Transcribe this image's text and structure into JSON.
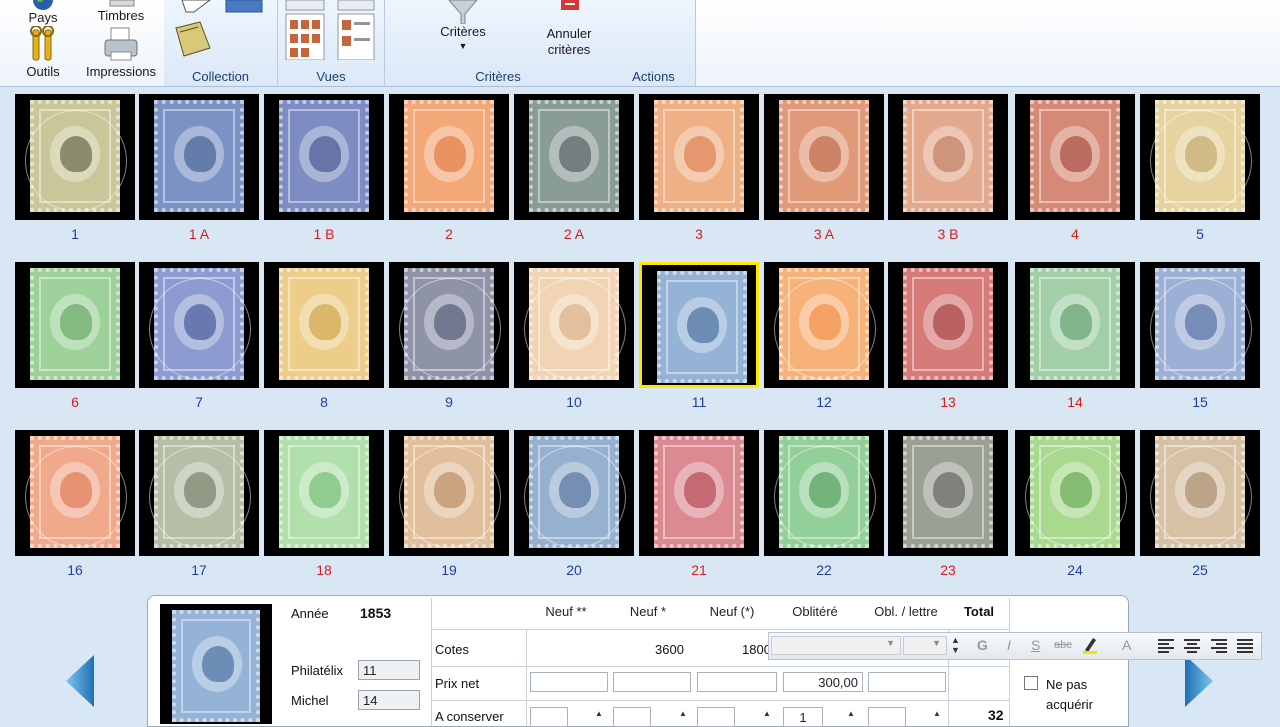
{
  "ribbon": {
    "left_buttons": [
      {
        "label": "Pays",
        "icon": "globe-icon"
      },
      {
        "label": "Timbres",
        "icon": "stamps-icon"
      },
      {
        "label": "Outils",
        "icon": "tools-icon"
      },
      {
        "label": "Impressions",
        "icon": "printer-icon"
      }
    ],
    "groups": [
      {
        "label": "Collection"
      },
      {
        "label": "Vues"
      },
      {
        "label": "Critères",
        "button": "Critères"
      },
      {
        "label": "Actions",
        "button_line1": "Annuler",
        "button_line2": "critères"
      }
    ]
  },
  "stamps": [
    {
      "num": "1",
      "red": false,
      "color": "#4a4a2a",
      "bg": "#c9c79a",
      "ring": true
    },
    {
      "num": "1 A",
      "red": true,
      "color": "#2d4a86",
      "bg": "#7b93c4",
      "ring": false
    },
    {
      "num": "1 B",
      "red": true,
      "color": "#2d3f80",
      "bg": "#7d8cc2",
      "ring": false
    },
    {
      "num": "2",
      "red": true,
      "color": "#e06a2a",
      "bg": "#f3a877",
      "ring": false
    },
    {
      "num": "2 A",
      "red": true,
      "color": "#3d4a4a",
      "bg": "#8a9c98",
      "ring": false
    },
    {
      "num": "3",
      "red": true,
      "color": "#d8703a",
      "bg": "#efb086",
      "ring": false
    },
    {
      "num": "3 A",
      "red": true,
      "color": "#b5532f",
      "bg": "#e09a7a",
      "ring": false
    },
    {
      "num": "3 B",
      "red": true,
      "color": "#b86a4d",
      "bg": "#e2a98f",
      "ring": false
    },
    {
      "num": "4",
      "red": true,
      "color": "#9a3026",
      "bg": "#d48a77",
      "ring": false
    },
    {
      "num": "5",
      "red": false,
      "color": "#b89a52",
      "bg": "#e6d3a0",
      "ring": true
    },
    {
      "num": "6",
      "red": true,
      "color": "#4f9a4f",
      "bg": "#9fd19a",
      "ring": false
    },
    {
      "num": "7",
      "red": false,
      "color": "#2b3f88",
      "bg": "#8d9cd0",
      "ring": true
    },
    {
      "num": "8",
      "red": false,
      "color": "#c9952f",
      "bg": "#eccd8a",
      "ring": false
    },
    {
      "num": "9",
      "red": false,
      "color": "#3a4462",
      "bg": "#8e93a8",
      "ring": true
    },
    {
      "num": "10",
      "red": false,
      "color": "#d2a277",
      "bg": "#f0d4b4",
      "ring": true
    },
    {
      "num": "11",
      "red": false,
      "color": "#2f5a92",
      "bg": "#94b3d6",
      "ring": false
    },
    {
      "num": "12",
      "red": false,
      "color": "#f07d2a",
      "bg": "#f7b27a",
      "ring": true
    },
    {
      "num": "13",
      "red": true,
      "color": "#9a2628",
      "bg": "#d67a7a",
      "ring": false
    },
    {
      "num": "14",
      "red": true,
      "color": "#4f8f5c",
      "bg": "#a2cfa8",
      "ring": false
    },
    {
      "num": "15",
      "red": false,
      "color": "#385b96",
      "bg": "#9bb0d4",
      "ring": true
    },
    {
      "num": "16",
      "red": false,
      "color": "#d8673f",
      "bg": "#f1a98c",
      "ring": true
    },
    {
      "num": "17",
      "red": false,
      "color": "#5e6a4e",
      "bg": "#b5bfa6",
      "ring": true
    },
    {
      "num": "18",
      "red": true,
      "color": "#5fb35f",
      "bg": "#b2e0ad",
      "ring": false
    },
    {
      "num": "19",
      "red": false,
      "color": "#b27a4d",
      "bg": "#e2bf9c",
      "ring": true
    },
    {
      "num": "20",
      "red": false,
      "color": "#3b5e8c",
      "bg": "#96b0cf",
      "ring": true
    },
    {
      "num": "21",
      "red": true,
      "color": "#a82d3a",
      "bg": "#dc8a92",
      "ring": false
    },
    {
      "num": "22",
      "red": false,
      "color": "#3b8f46",
      "bg": "#93cf98",
      "ring": true
    },
    {
      "num": "23",
      "red": true,
      "color": "#4a4f46",
      "bg": "#9ba095",
      "ring": false
    },
    {
      "num": "24",
      "red": false,
      "color": "#4c9a3a",
      "bg": "#a9d98f",
      "ring": true
    },
    {
      "num": "25",
      "red": false,
      "color": "#9a7b5a",
      "bg": "#d7c1a4",
      "ring": true
    }
  ],
  "selected_stamp": "11",
  "detail": {
    "annee_label": "Année",
    "annee_value": "1853",
    "philatelix_label": "Philatélix",
    "philatelix_value": "11",
    "michel_label": "Michel",
    "michel_value": "14",
    "columns": [
      "Neuf **",
      "Neuf *",
      "Neuf (*)",
      "Oblitéré",
      "Obl. / lettre",
      "Total"
    ],
    "rows": {
      "cotes": {
        "label": "Cotes",
        "neuf1": "3600",
        "neuf2": "1800"
      },
      "prix_net": {
        "label": "Prix net",
        "oblitere": "300,00"
      },
      "a_conserver": {
        "label": "A conserver",
        "oblitere": "1",
        "total": "32"
      }
    },
    "ne_pas_acquerir_line1": "Ne pas",
    "ne_pas_acquerir_line2": "acquérir"
  },
  "format_toolbar": {
    "buttons": [
      "G",
      "I",
      "S",
      "abc",
      "A"
    ]
  },
  "colors": {
    "selection": "#ffe800",
    "red_caption": "#d21f1f",
    "blue_caption": "#1f3f99",
    "nav_arrow": "#2f7fc1"
  }
}
